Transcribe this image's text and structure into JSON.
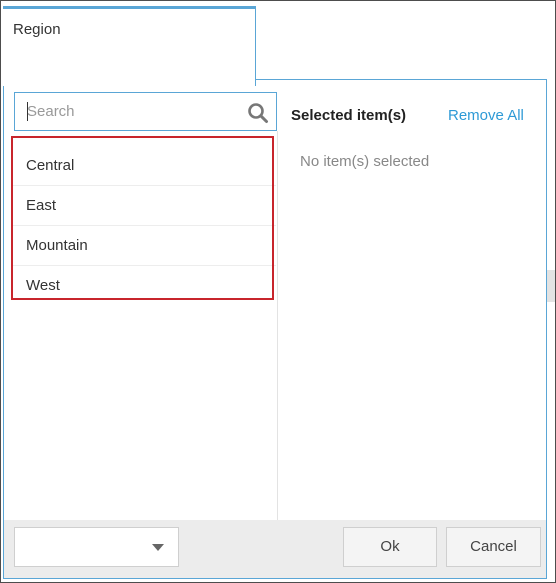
{
  "tab": {
    "label": "Region"
  },
  "search": {
    "placeholder": "Search",
    "value": ""
  },
  "list": {
    "items": [
      {
        "label": "Central"
      },
      {
        "label": "East"
      },
      {
        "label": "Mountain"
      },
      {
        "label": "West"
      }
    ]
  },
  "selected": {
    "header": "Selected item(s)",
    "remove_all_label": "Remove All",
    "empty_message": "No item(s) selected"
  },
  "footer": {
    "dropdown_value": "",
    "ok_label": "Ok",
    "cancel_label": "Cancel"
  },
  "colors": {
    "accent": "#5aa6d6",
    "link": "#2e9ad6",
    "highlight": "#c8252c"
  },
  "icons": {
    "search": "search-icon",
    "dropdown": "chevron-down-icon"
  }
}
